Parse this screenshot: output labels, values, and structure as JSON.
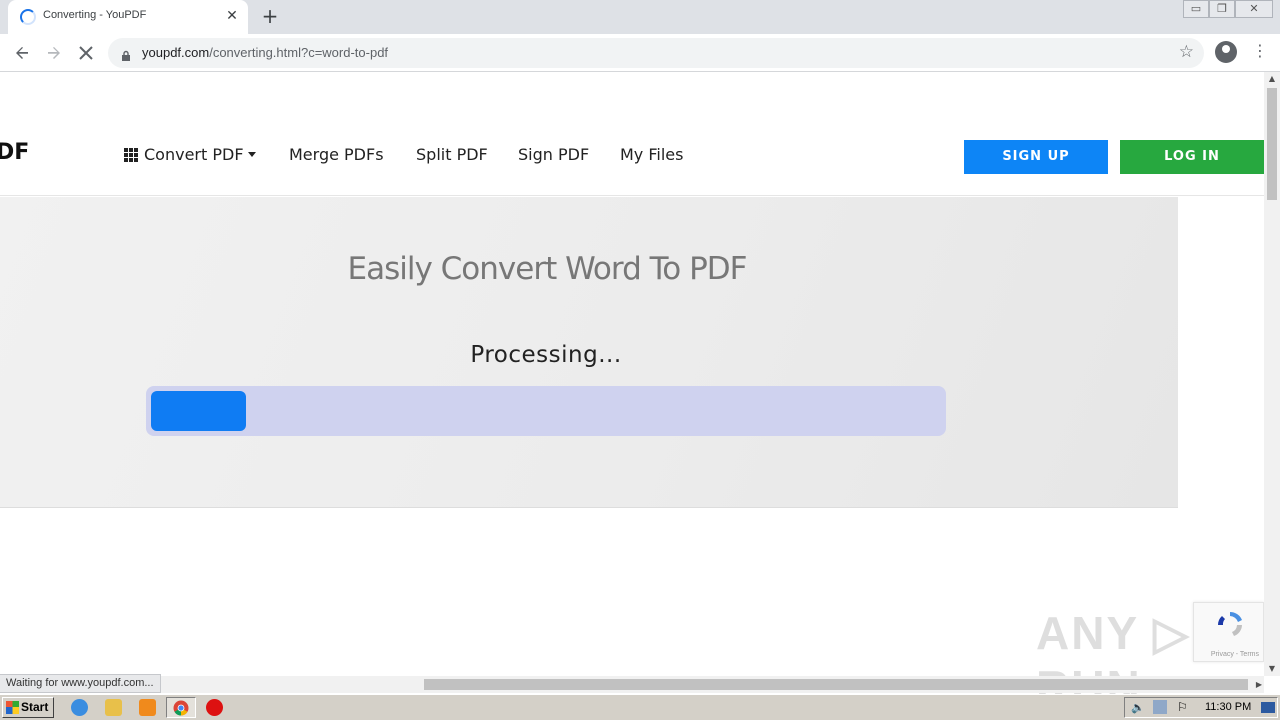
{
  "browser": {
    "tab_title": "Converting - YouPDF",
    "tab_close": "✕",
    "new_tab": "+",
    "url_host": "youpdf.com",
    "url_path": "/converting.html?c=word-to-pdf",
    "window_buttons": [
      "▭",
      "❐",
      "✕"
    ],
    "status_text": "Waiting for www.youpdf.com..."
  },
  "site": {
    "logo_text": "DF",
    "nav": {
      "convert": "Convert PDF",
      "merge": "Merge PDFs",
      "split": "Split PDF",
      "sign": "Sign PDF",
      "files": "My Files"
    },
    "signup_label": "SIGN UP",
    "login_label": "LOG IN"
  },
  "hero": {
    "title": "Easily Convert Word To PDF",
    "status": "Processing...",
    "progress_fraction": 0.12,
    "progress_color": "#0f7cf3",
    "track_color": "#cfd2ef"
  },
  "recaptcha": {
    "text": "Privacy - Terms"
  },
  "watermark": "ANY ▷ RUN",
  "taskbar": {
    "start_label": "Start",
    "clock": "11:30 PM"
  },
  "colors": {
    "signup": "#0d85f6",
    "login": "#27a83f"
  }
}
